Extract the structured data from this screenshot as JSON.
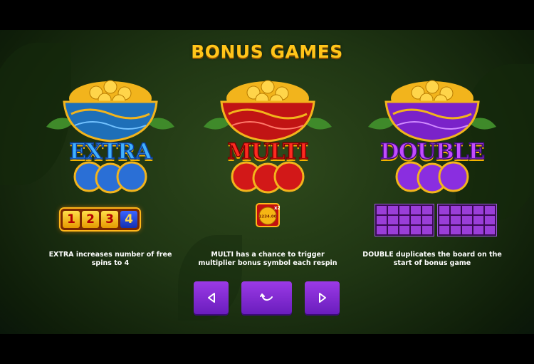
{
  "title": "BONUS GAMES",
  "bonuses": [
    {
      "key": "extra",
      "word": "EXTRA",
      "description": "EXTRA increases number of free spins to 4",
      "accent": "#3fb1ff",
      "spins": [
        "1",
        "2",
        "3",
        "4"
      ]
    },
    {
      "key": "multi",
      "word": "MULTI",
      "description": "MULTI has a chance to trigger multiplier bonus symbol each respin",
      "accent": "#ff2a20",
      "multiplier_badge": "x2",
      "multiplier_value": "1234.00"
    },
    {
      "key": "double",
      "word": "DOUBLE",
      "description": "DOUBLE duplicates the board on the start of bonus game",
      "accent": "#c24cff"
    }
  ],
  "controls": {
    "prev_icon": "triangle-left-icon",
    "back_icon": "return-arrow-icon",
    "next_icon": "triangle-right-icon"
  },
  "colors": {
    "title": "#ffc51a",
    "button": "#7a27cf",
    "gold": "#f4b400"
  }
}
